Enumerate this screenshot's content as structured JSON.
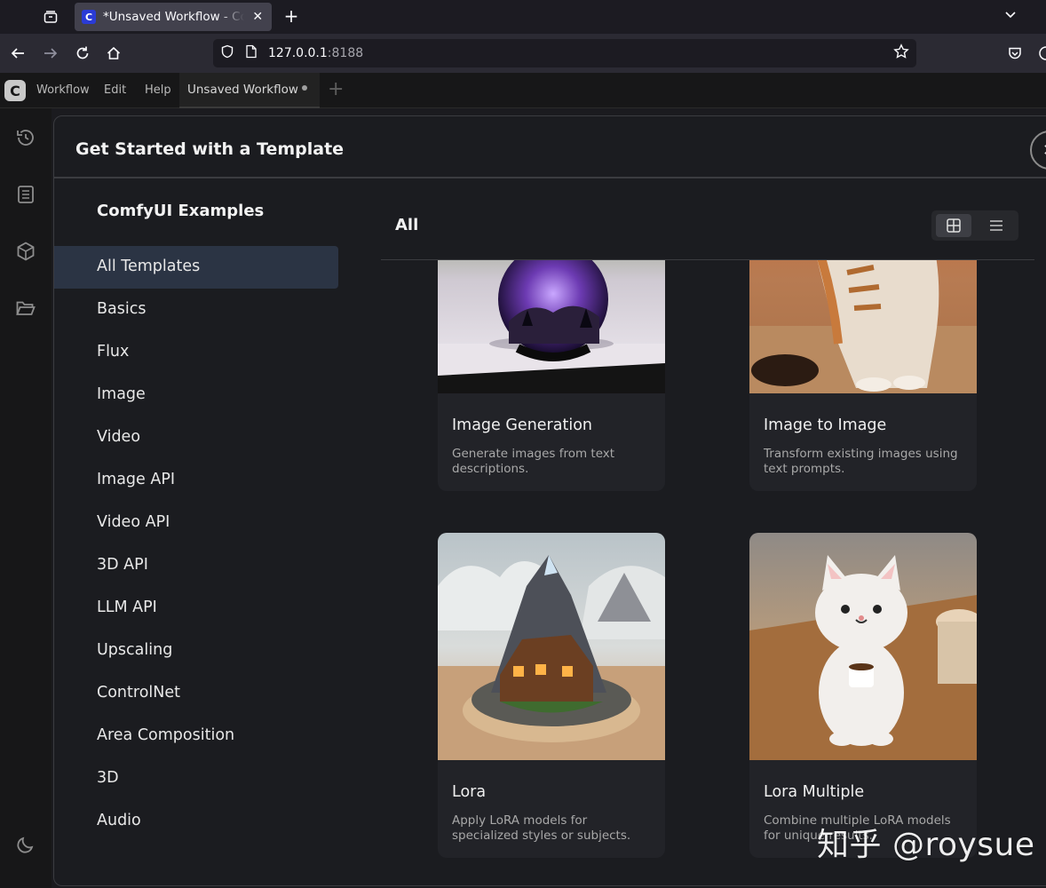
{
  "browser": {
    "tab_title": "*Unsaved Workflow - ComfyUI",
    "tab_favicon": "C",
    "url_host": "127.0.0.1",
    "url_port": ":8188"
  },
  "app": {
    "logo": "C",
    "menu": [
      "Workflow",
      "Edit",
      "Help"
    ],
    "workflow_tab": "Unsaved Workflow"
  },
  "dialog": {
    "title": "Get Started with a Template",
    "sidebar_heading": "ComfyUI Examples",
    "categories": [
      "All Templates",
      "Basics",
      "Flux",
      "Image",
      "Video",
      "Image API",
      "Video API",
      "3D API",
      "LLM API",
      "Upscaling",
      "ControlNet",
      "Area Composition",
      "3D",
      "Audio"
    ],
    "active_category": "All Templates",
    "main_title": "All",
    "view_mode": "grid",
    "cards": [
      {
        "title": "Image Generation",
        "description": "Generate images from text descriptions.",
        "image": "crystal-ball-galaxy-thumbnail"
      },
      {
        "title": "Image to Image",
        "description": "Transform existing images using text prompts.",
        "image": "tabby-cat-thumbnail"
      },
      {
        "title": "Lora",
        "description": "Apply LoRA models for specialized styles or subjects.",
        "image": "mountain-cabin-diorama-thumbnail"
      },
      {
        "title": "Lora Multiple",
        "description": "Combine multiple LoRA models for unique results.",
        "image": "white-ceramic-cat-coffee-thumbnail"
      }
    ]
  },
  "watermark": "知乎 @roysue"
}
